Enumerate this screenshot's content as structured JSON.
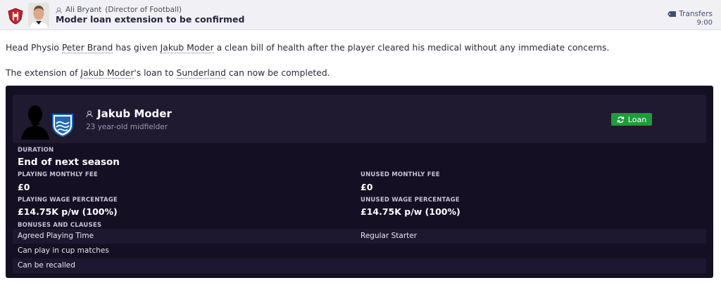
{
  "header": {
    "sender_name": "Ali Bryant",
    "sender_role": "(Director of Football)",
    "subject": "Moder loan extension to be confirmed",
    "category": "Transfers",
    "time": "9:00",
    "icons": [
      "club-badge-icon",
      "person-icon",
      "tag-icon"
    ]
  },
  "message": {
    "p1_pre": "Head Physio ",
    "p1_physio": "Peter Brand",
    "p1_mid": " has given ",
    "p1_player": "Jakub Moder",
    "p1_post": " a clean bill of health after the player cleared his medical without any immediate concerns.",
    "p2_pre": "The extension of ",
    "p2_player": "Jakub Moder",
    "p2_mid": "'s loan to ",
    "p2_club": "Sunderland",
    "p2_post": " can now be completed."
  },
  "player": {
    "name": "Jakub Moder",
    "description": "23 year-old midfielder",
    "button_label": "Loan"
  },
  "loan": {
    "duration_label": "DURATION",
    "duration_value": "End of next season",
    "playing_fee_label": "PLAYING MONTHLY FEE",
    "playing_fee_value": "£0",
    "unused_fee_label": "UNUSED MONTHLY FEE",
    "unused_fee_value": "£0",
    "playing_wage_label": "PLAYING WAGE PERCENTAGE",
    "playing_wage_value": "£14.75K p/w (100%)",
    "unused_wage_label": "UNUSED WAGE PERCENTAGE",
    "unused_wage_value": "£14.75K p/w (100%)",
    "bonuses_label": "BONUSES AND CLAUSES",
    "clauses": [
      {
        "left": "Agreed Playing Time",
        "right": "Regular Starter"
      },
      {
        "left": "Can play in cup matches",
        "right": ""
      },
      {
        "left": "Can be recalled",
        "right": ""
      }
    ]
  },
  "colors": {
    "panel_bg": "#150f23",
    "card_bg": "#201a31",
    "loan_button": "#1f9c3a",
    "header_bg": "#f1f1f5"
  }
}
